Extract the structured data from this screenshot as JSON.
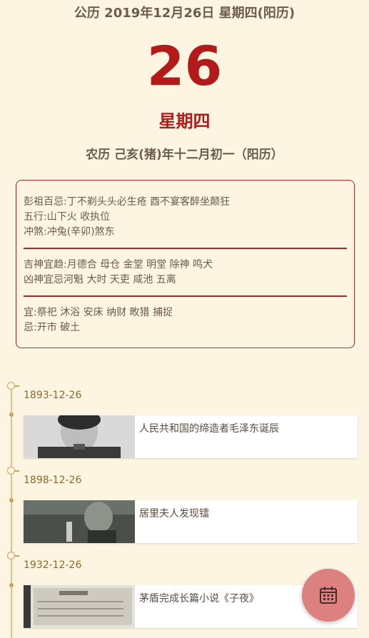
{
  "header": {
    "solar_date": "公历 2019年12月26日 星期四(阳历)",
    "day": "26",
    "weekday": "星期四",
    "lunar_date": "农历 己亥(猪)年十二月初一（阳历）"
  },
  "almanac": {
    "section1": [
      "彭祖百忌:丁不剃头头必生疮 酉不宴客醉坐颠狂",
      "五行:山下火 收执位",
      "冲煞:冲兔(辛卯)煞东"
    ],
    "section2": [
      "吉神宜趋:月德合 母仓 金堂 明堂 除神 鸣犬",
      "凶神宜忌河魁 大时 天吏 咸池 五离"
    ],
    "section3": [
      "宜:祭祀 沐浴 安床 纳财 畋猎 捕捉",
      "忌:开市 破土"
    ]
  },
  "events": [
    {
      "date": "1893-12-26",
      "title": "人民共和国的缔造者毛泽东诞辰"
    },
    {
      "date": "1898-12-26",
      "title": "居里夫人发现镭"
    },
    {
      "date": "1932-12-26",
      "title": "茅盾完成长篇小说《子夜》"
    }
  ],
  "fab": {
    "icon": "calendar-icon"
  },
  "colors": {
    "accent": "#b31b1b",
    "background": "#fdf4e1",
    "fab": "#dc8080",
    "timeline": "#c8a45a"
  }
}
